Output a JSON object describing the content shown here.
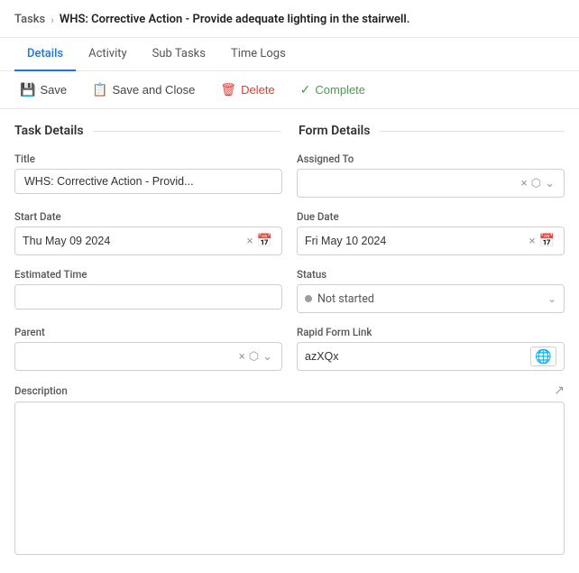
{
  "breadcrumb": {
    "tasks_label": "Tasks",
    "separator": "›",
    "current": "WHS: Corrective Action - Provide adequate lighting in the stairwell."
  },
  "tabs": [
    {
      "id": "details",
      "label": "Details",
      "active": true
    },
    {
      "id": "activity",
      "label": "Activity",
      "active": false
    },
    {
      "id": "subtasks",
      "label": "Sub Tasks",
      "active": false
    },
    {
      "id": "timelogs",
      "label": "Time Logs",
      "active": false
    }
  ],
  "toolbar": {
    "save": "Save",
    "save_and_close": "Save and Close",
    "delete": "Delete",
    "complete": "Complete"
  },
  "task_details_header": "Task Details",
  "form_details_header": "Form Details",
  "fields": {
    "title_label": "Title",
    "title_value": "WHS: Corrective Action - Provid...",
    "assigned_to_label": "Assigned To",
    "assigned_to_value": "",
    "start_date_label": "Start Date",
    "start_date_value": "Thu May 09 2024",
    "due_date_label": "Due Date",
    "due_date_value": "Fri May 10 2024",
    "estimated_time_label": "Estimated Time",
    "estimated_time_value": "",
    "status_label": "Status",
    "status_value": "Not started",
    "parent_label": "Parent",
    "parent_value": "",
    "rapid_form_label": "Rapid Form Link",
    "rapid_form_value": "azXQx",
    "description_label": "Description",
    "description_value": ""
  },
  "icons": {
    "save": "💾",
    "save_close": "📋",
    "delete": "🗑",
    "complete_check": "✓",
    "clear_x": "×",
    "open_link": "↗",
    "dropdown": "⌄",
    "calendar": "📅",
    "globe": "🌐",
    "expand": "↗"
  },
  "colors": {
    "active_tab": "#1a73e8",
    "delete": "#e53935",
    "complete": "#43a047",
    "status_dot": "#9e9e9e"
  }
}
